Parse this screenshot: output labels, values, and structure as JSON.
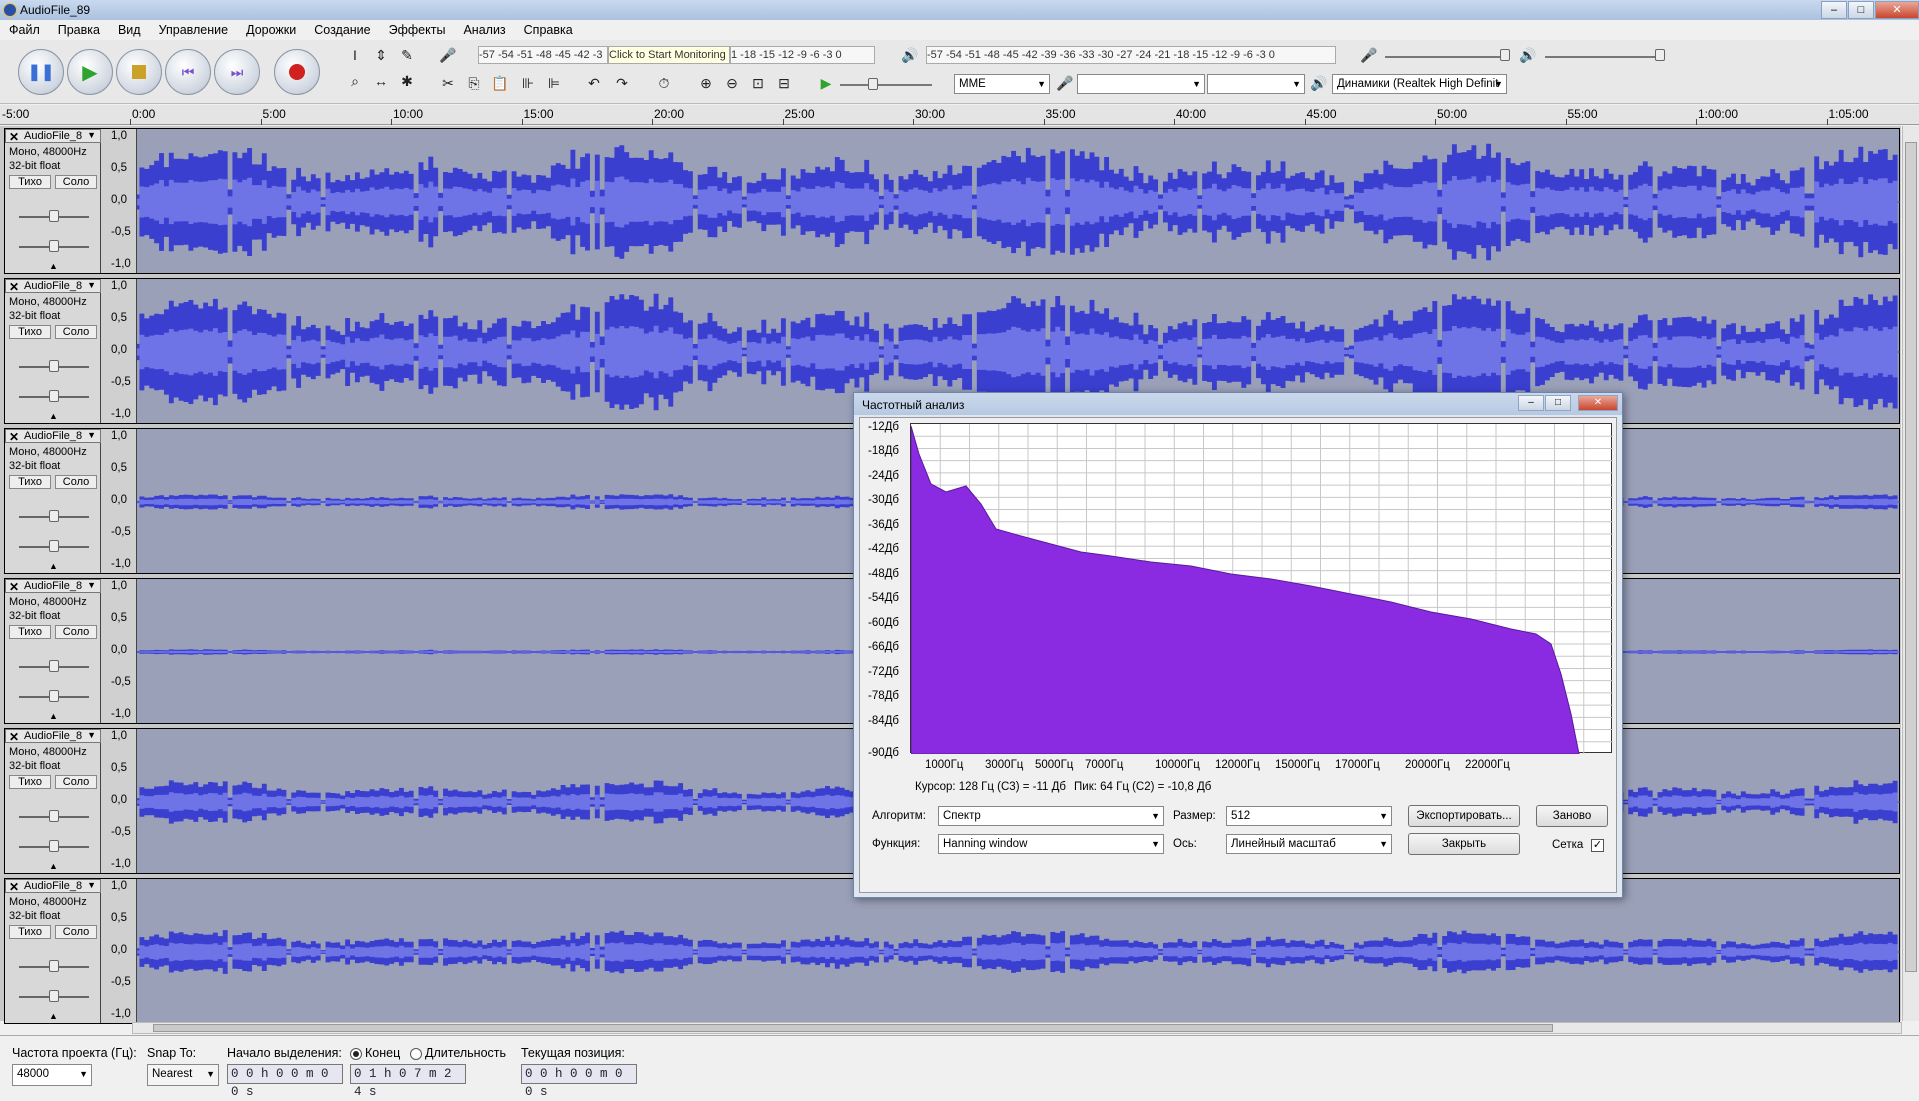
{
  "window": {
    "title": "AudioFile_89"
  },
  "menu": [
    "Файл",
    "Правка",
    "Вид",
    "Управление",
    "Дорожки",
    "Создание",
    "Эффекты",
    "Анализ",
    "Справка"
  ],
  "toolbar": {
    "monitor_tooltip": "Click to Start Monitoring",
    "rec_meter_ticks": "-57 -54 -51 -48 -45 -42 -3",
    "rec_meter_ticks2": "1 -18 -15 -12 -9 -6 -3 0",
    "play_meter_ticks": "-57 -54 -51 -48 -45 -42 -39 -36 -33 -30 -27 -24 -21 -18 -15 -12 -9 -6 -3 0",
    "host": "MME",
    "rec_device": "",
    "rec_channels": "",
    "play_device": "Динамики (Realtek High Definit"
  },
  "ruler": {
    "start": "-5:00",
    "ticks": [
      "0:00",
      "5:00",
      "10:00",
      "15:00",
      "20:00",
      "25:00",
      "30:00",
      "35:00",
      "40:00",
      "45:00",
      "50:00",
      "55:00",
      "1:00:00",
      "1:05:00"
    ]
  },
  "track_common": {
    "name": "AudioFile_8",
    "format": "Моно, 48000Hz",
    "bits": "32-bit float",
    "mute": "Тихо",
    "solo": "Соло",
    "scale": [
      "1,0",
      "0,5",
      "0,0",
      "-0,5",
      "-1,0"
    ]
  },
  "tracks": [
    {
      "amp": 0.85
    },
    {
      "amp": 0.85
    },
    {
      "amp": 0.12
    },
    {
      "amp": 0.04
    },
    {
      "amp": 0.32
    },
    {
      "amp": 0.32
    }
  ],
  "dialog": {
    "title": "Частотный анализ",
    "y_labels": [
      "-12Дб",
      "-18Дб",
      "-24Дб",
      "-30Дб",
      "-36Дб",
      "-42Дб",
      "-48Дб",
      "-54Дб",
      "-60Дб",
      "-66Дб",
      "-72Дб",
      "-78Дб",
      "-84Дб",
      "-90Дб"
    ],
    "x_labels": [
      "1000Гц",
      "3000Гц",
      "5000Гц",
      "7000Гц",
      "10000Гц",
      "12000Гц",
      "15000Гц",
      "17000Гц",
      "20000Гц",
      "22000Гц"
    ],
    "cursor_text": "Курсор: 128 Гц (C3) = -11 Дб",
    "peak_text": "Пик: 64 Гц (C2) = -10,8 Дб",
    "algorithm_label": "Алгоритм:",
    "algorithm_value": "Спектр",
    "size_label": "Размер:",
    "size_value": "512",
    "export_button": "Экспортировать...",
    "replot_button": "Заново",
    "function_label": "Функция:",
    "function_value": "Hanning window",
    "axis_label": "Ось:",
    "axis_value": "Линейный масштаб",
    "close_button": "Закрыть",
    "grid_label": "Сетка",
    "grid_checked": true,
    "fill_color": "#8a2be2"
  },
  "status": {
    "rate_label": "Частота проекта (Гц):",
    "rate_value": "48000",
    "snap_label": "Snap To:",
    "snap_value": "Nearest",
    "sel_start_label": "Начало выделения:",
    "end_label": "Конец",
    "length_label": "Длительность",
    "sel_start_value": "0 0 h 0 0 m 0 0 s",
    "sel_end_value": "0 1 h 0 7 m 2 4 s",
    "position_label": "Текущая позиция:",
    "position_value": "0 0 h 0 0 m 0 0 s"
  },
  "colors": {
    "wave": "#3a3fd0",
    "wave_rms": "#6e74e6",
    "track_bg": "#9aa0b8"
  }
}
